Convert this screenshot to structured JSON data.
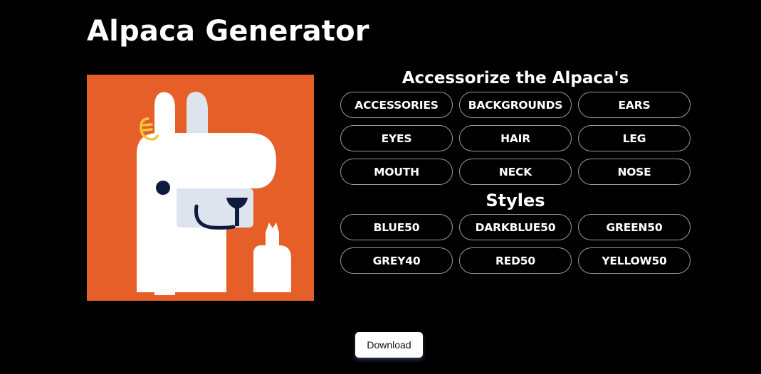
{
  "app": {
    "title": "Alpaca Generator"
  },
  "accessorize": {
    "heading": "Accessorize the Alpaca's",
    "items": [
      {
        "label": "ACCESSORIES"
      },
      {
        "label": "BACKGROUNDS"
      },
      {
        "label": "EARS"
      },
      {
        "label": "EYES"
      },
      {
        "label": "HAIR"
      },
      {
        "label": "LEG"
      },
      {
        "label": "MOUTH"
      },
      {
        "label": "NECK"
      },
      {
        "label": "NOSE"
      }
    ]
  },
  "styles": {
    "heading": "Styles",
    "items": [
      {
        "label": "BLUE50"
      },
      {
        "label": "DARKBLUE50"
      },
      {
        "label": "GREEN50"
      },
      {
        "label": "GREY40"
      },
      {
        "label": "RED50"
      },
      {
        "label": "YELLOW50"
      }
    ]
  },
  "download": {
    "label": "Download"
  },
  "colors": {
    "background": "#E65F28",
    "alpaca": "#FFFFFF",
    "muzzle": "#DDE4EE",
    "features": "#0E1B3D",
    "ears_inner": "#DDE4EE",
    "accessory": "#F5C73B"
  }
}
